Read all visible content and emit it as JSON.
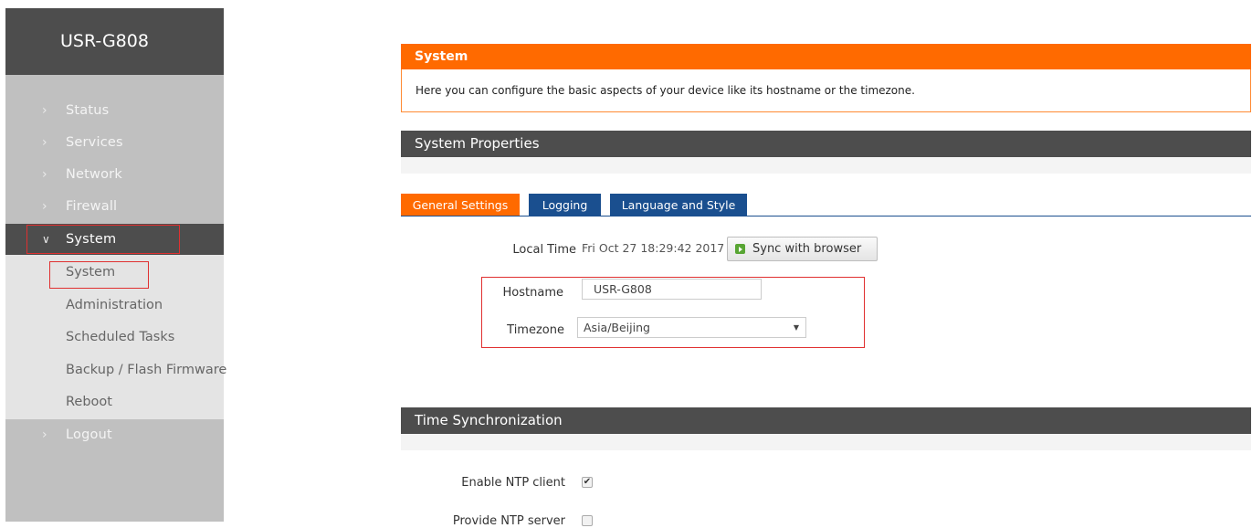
{
  "brand": "USR-G808",
  "menu": {
    "status": "Status",
    "services": "Services",
    "network": "Network",
    "firewall": "Firewall",
    "system": "System",
    "logout": "Logout"
  },
  "submenu": [
    "System",
    "Administration",
    "Scheduled Tasks",
    "Backup / Flash Firmware",
    "Reboot"
  ],
  "header": {
    "title": "System",
    "description": "Here you can configure the basic aspects of your device like its hostname or the timezone."
  },
  "properties_title": "System Properties",
  "tabs": [
    "General Settings",
    "Logging",
    "Language and Style"
  ],
  "general": {
    "local_time_label": "Local Time",
    "local_time_value": "Fri Oct 27 18:29:42 2017",
    "sync_button": "Sync with browser",
    "hostname_label": "Hostname",
    "hostname_value": "USR-G808",
    "timezone_label": "Timezone",
    "timezone_value": "Asia/Beijing"
  },
  "time_sync": {
    "title": "Time Synchronization",
    "enable_ntp_label": "Enable NTP client",
    "provide_ntp_label": "Provide NTP server"
  },
  "colors": {
    "orange": "#ff6a00",
    "dark": "#4d4d4d",
    "tab_blue": "#1a4f8f",
    "highlight": "#e03030"
  }
}
